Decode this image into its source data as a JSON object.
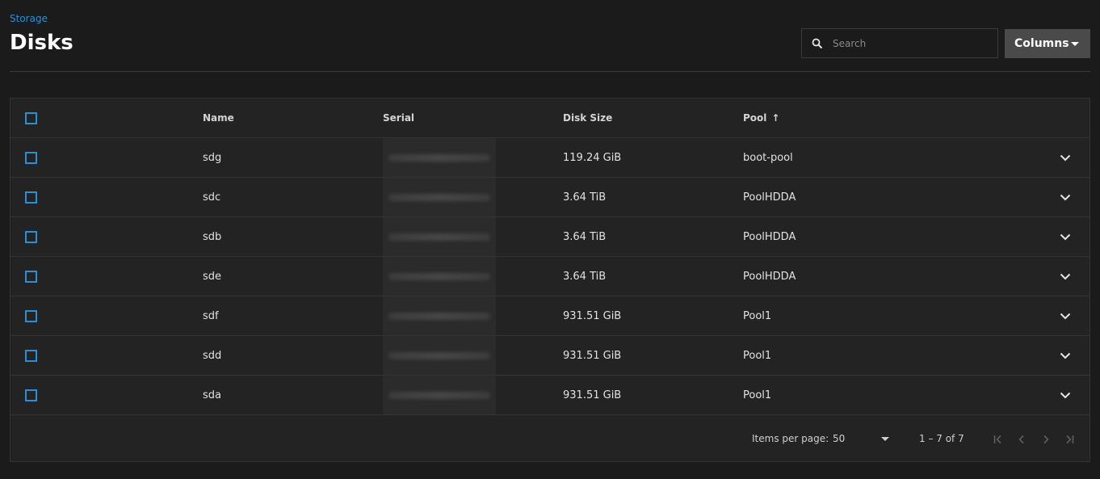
{
  "breadcrumb": "Storage",
  "page_title": "Disks",
  "search": {
    "placeholder": "Search",
    "value": ""
  },
  "columns_button": {
    "label": "Columns"
  },
  "table": {
    "headers": {
      "name": "Name",
      "serial": "Serial",
      "disk_size": "Disk Size",
      "pool": "Pool",
      "pool_sort": "↑"
    },
    "rows": [
      {
        "name": "sdg",
        "disk_size": "119.24 GiB",
        "pool": "boot-pool"
      },
      {
        "name": "sdc",
        "disk_size": "3.64 TiB",
        "pool": "PoolHDDA"
      },
      {
        "name": "sdb",
        "disk_size": "3.64 TiB",
        "pool": "PoolHDDA"
      },
      {
        "name": "sde",
        "disk_size": "3.64 TiB",
        "pool": "PoolHDDA"
      },
      {
        "name": "sdf",
        "disk_size": "931.51 GiB",
        "pool": "Pool1"
      },
      {
        "name": "sdd",
        "disk_size": "931.51 GiB",
        "pool": "Pool1"
      },
      {
        "name": "sda",
        "disk_size": "931.51 GiB",
        "pool": "Pool1"
      }
    ]
  },
  "paginator": {
    "items_per_page_label": "Items per page:",
    "items_per_page_value": "50",
    "range_label": "1 – 7 of 7"
  },
  "colors": {
    "accent": "#2a8fd6",
    "background": "#1b1b1b",
    "card": "#232323"
  },
  "icons": {
    "search": "search-icon",
    "expand": "chevron-down-icon",
    "first": "first-page-icon",
    "prev": "chevron-left-icon",
    "next": "chevron-right-icon",
    "last": "last-page-icon"
  }
}
